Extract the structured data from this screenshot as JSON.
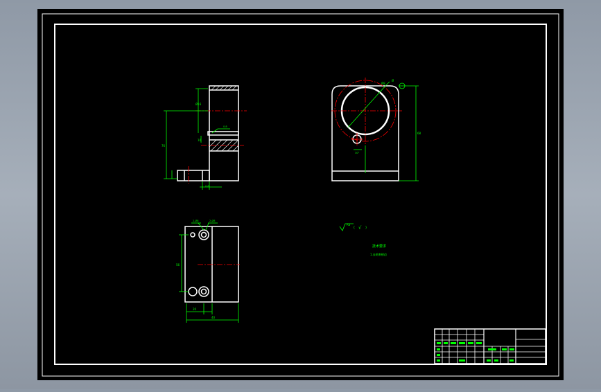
{
  "viewer": {
    "background_color": "#9aa3ae",
    "paper_color": "#000000",
    "frame_color": "#ffffff",
    "dimension_color": "#00ff00",
    "centerline_color": "#ff0000"
  },
  "annotations": {
    "roughness_symbol": "√",
    "tech_title": "技术要求",
    "tech_note": "1.去毛刺锐边",
    "diameter_symbol": "Ø"
  },
  "title_block": {
    "rows": 6,
    "label_cells": 12
  }
}
